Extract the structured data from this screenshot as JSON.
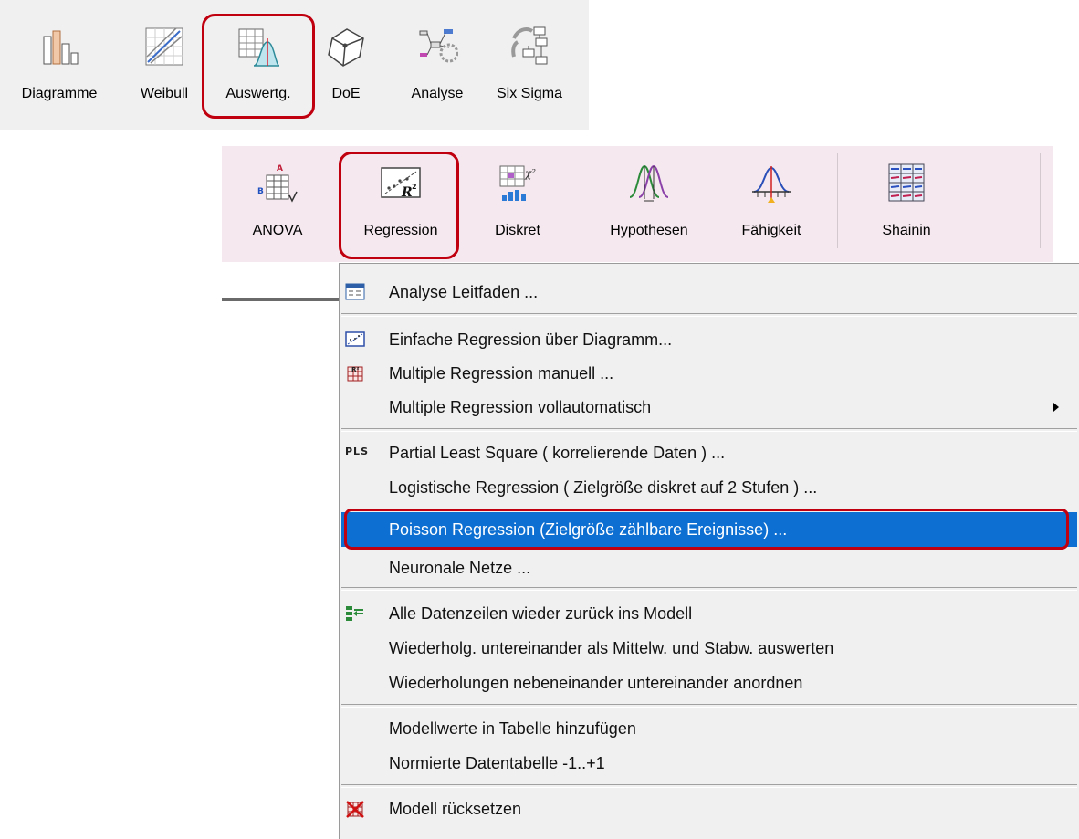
{
  "toolbar_top": {
    "buttons": [
      {
        "label": "Diagramme",
        "icon": "bar-chart-icon"
      },
      {
        "label": "Weibull",
        "icon": "weibull-plot-icon"
      },
      {
        "label": "Auswertg.",
        "icon": "evaluation-distribution-icon"
      },
      {
        "label": "DoE",
        "icon": "doe-cube-icon"
      },
      {
        "label": "Analyse",
        "icon": "analysis-network-icon"
      },
      {
        "label": "Six Sigma",
        "icon": "six-sigma-cycle-icon"
      }
    ]
  },
  "ribbon": {
    "buttons": [
      {
        "label": "ANOVA",
        "icon": "anova-table-icon"
      },
      {
        "label": "Regression",
        "icon": "regression-r2-icon"
      },
      {
        "label": "Diskret",
        "icon": "chi-square-icon"
      },
      {
        "label": "Hypothesen",
        "icon": "hypothesis-distributions-icon"
      },
      {
        "label": "Fähigkeit",
        "icon": "capability-curve-icon"
      },
      {
        "label": "Shainin",
        "icon": "shainin-grid-icon"
      }
    ]
  },
  "menu": {
    "items": [
      {
        "label": "Analyse Leitfaden ...",
        "icon": "guide-icon"
      },
      {
        "label": "Einfache Regression über Diagramm...",
        "icon": "simple-regression-icon"
      },
      {
        "label": "Multiple Regression manuell ...",
        "icon": "multiple-regression-icon"
      },
      {
        "label": "Multiple Regression vollautomatisch",
        "has_submenu": true
      },
      {
        "label": "Partial Least Square  ( korrelierende Daten ) ...",
        "icon": "pls-icon",
        "icon_text": "PLS"
      },
      {
        "label": "Logistische Regression  ( Zielgröße diskret auf 2 Stufen ) ..."
      },
      {
        "label": "Poisson Regression (Zielgröße zählbare Ereignisse) ...",
        "highlighted": true
      },
      {
        "label": "Neuronale Netze ..."
      },
      {
        "label": "Alle Datenzeilen wieder zurück ins Modell",
        "icon": "restore-rows-icon"
      },
      {
        "label": "Wiederholg. untereinander als Mittelw. und Stabw. auswerten"
      },
      {
        "label": "Wiederholungen nebeneinander untereinander anordnen"
      },
      {
        "label": "Modellwerte in Tabelle hinzufügen"
      },
      {
        "label": "Normierte Datentabelle  -1..+1"
      },
      {
        "label": "Modell rücksetzen",
        "icon": "reset-model-icon"
      }
    ]
  },
  "colors": {
    "highlight_frame": "#c0000f",
    "menu_highlight": "#0d6fd1",
    "ribbon_background": "#f5e9ef",
    "toolbar_background": "#f0f0f0"
  }
}
